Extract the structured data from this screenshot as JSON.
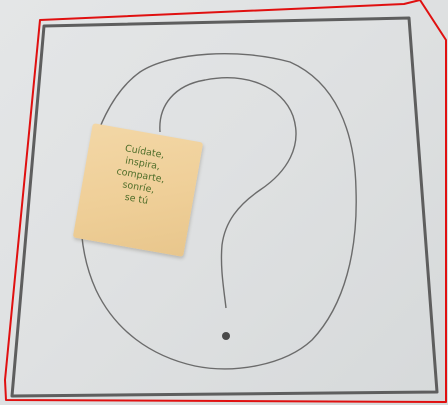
{
  "photo": {
    "subject": "hand-drawn question mark on paper with a tea tag",
    "tag_text_lines": [
      "Cuídate,",
      "inspira,",
      "comparte,",
      "sonríe,",
      "se tú"
    ],
    "colors": {
      "paper": "#e2e4e5",
      "pencil": "#6b6b6b",
      "tag": "#efcf98",
      "tag_text": "#4f6e2a",
      "frame_outline": "#e01010"
    }
  }
}
